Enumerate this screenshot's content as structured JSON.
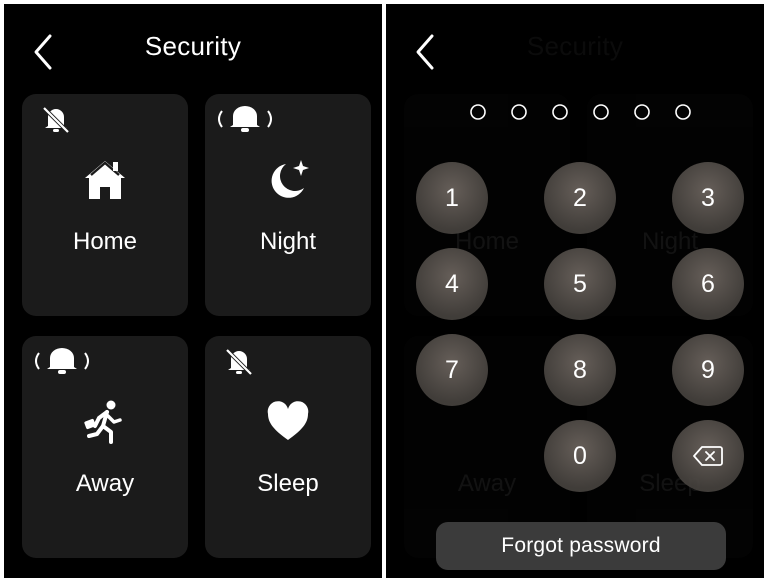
{
  "left_screen": {
    "title": "Security",
    "back_icon": "chevron-left-icon",
    "modes": [
      {
        "label": "Home",
        "icon": "house-icon",
        "alarm": "bell-off-icon"
      },
      {
        "label": "Night",
        "icon": "moon-star-icon",
        "alarm": "bell-ringing-icon"
      },
      {
        "label": "Away",
        "icon": "running-person-icon",
        "alarm": "bell-ringing-icon"
      },
      {
        "label": "Sleep",
        "icon": "heart-icon",
        "alarm": "bell-off-icon"
      }
    ]
  },
  "right_screen": {
    "title": "Security",
    "back_icon": "chevron-left-icon",
    "pin_length": 6,
    "pin_entered": 0,
    "keypad": [
      "1",
      "2",
      "3",
      "4",
      "5",
      "6",
      "7",
      "8",
      "9",
      "0"
    ],
    "backspace_icon": "backspace-icon",
    "forgot_label": "Forgot password",
    "background_ghost_labels": [
      "Home",
      "Night",
      "Away",
      "Sleep"
    ]
  },
  "colors": {
    "background": "#000000",
    "tile": "#1b1b1b",
    "key": "#5f5955",
    "forgot_button": "#3b3b3b",
    "text": "#ffffff"
  }
}
